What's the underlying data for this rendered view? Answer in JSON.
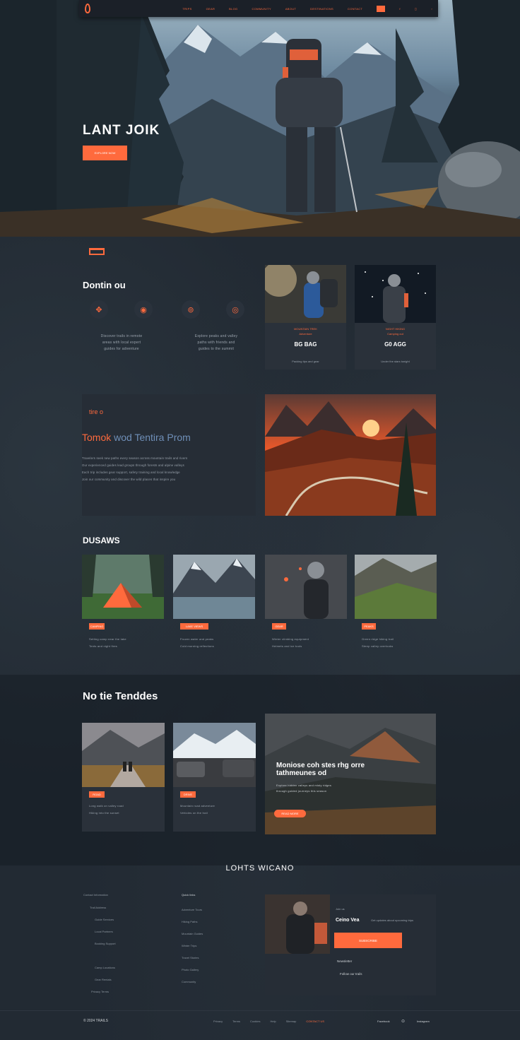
{
  "nav": {
    "links": [
      "TRIPS",
      "GEAR",
      "BLOG",
      "COMMUNITY",
      "ABOUT",
      "DESTINATIONS",
      "CONTACT"
    ],
    "badge": "EN",
    "icons": [
      "facebook-icon",
      "instagram-icon",
      "arrow-right-icon"
    ]
  },
  "hero": {
    "title": "LANT JOIK",
    "button": "EXPLORE NOW"
  },
  "features": {
    "title": "Dontin ou",
    "icons": [
      "compass-icon",
      "signal-icon",
      "target-icon",
      "location-icon"
    ],
    "text_left": [
      "Discover trails in remote",
      "areas with local expert",
      "guides for adventure"
    ],
    "text_right": [
      "Explore peaks and valley",
      "paths with friends and",
      "guides to the summit"
    ],
    "cards": [
      {
        "tag": "MOUNTAIN TREK",
        "subtag": "Adventure",
        "title": "BG BAG",
        "desc": "Packing tips and gear"
      },
      {
        "tag": "NIGHT HIKING",
        "subtag": "Camping out",
        "title": "G0 AGG",
        "desc": "Under the stars tonight"
      }
    ]
  },
  "about": {
    "kicker": "tire o",
    "title_orange": "Tomok",
    "title_rest": "wod Tentira Prom",
    "lines": [
      "Travelers seek new paths every season across mountain trails and rivers",
      "Our experienced guides lead groups through forests and alpine valleys",
      "Each trip includes gear support, safety training and local knowledge",
      "Join our community and discover the wild places that inspire you"
    ]
  },
  "gallery": {
    "title": "DUSAWS",
    "items": [
      {
        "tag": "CAMPING",
        "lines": [
          "Setting camp near the lake",
          "Tents and night fires"
        ]
      },
      {
        "tag": "LAKE VIEWS",
        "lines": [
          "Frozen water and peaks",
          "Cold morning reflections"
        ]
      },
      {
        "tag": "GEAR",
        "lines": [
          "Winter climbing equipment",
          "Helmets and ice tools"
        ]
      },
      {
        "tag": "PEAKS",
        "lines": [
          "Green ridge hiking trail",
          "Steep valley overlooks"
        ]
      }
    ]
  },
  "trending": {
    "title": "No tie Tenddes",
    "items": [
      {
        "tag": "ROAD",
        "lines": [
          "Long walk on valley road",
          "Hiking into the sunset"
        ]
      },
      {
        "tag": "DRIVE",
        "lines": [
          "Mountain road adventure",
          "Vehicles on the trail"
        ]
      }
    ],
    "feature": {
      "title": "Moniose coh stes rhg orre tathmeunes od",
      "lines": [
        "Explore hidden valleys and misty ridges",
        "through guided journeys this season"
      ],
      "button": "READ MORE"
    }
  },
  "footer_section": {
    "title": "LOHTS WICANO",
    "col1": [
      "Contact Information",
      "Trail Address",
      "Guide Services",
      "Local Partners",
      "Booking Support",
      "Camp Locations",
      "Gear Rentals",
      "Privacy Terms"
    ],
    "col2_head": "Quick links",
    "col2": [
      "Adventure Tours",
      "Hiking Paths",
      "Mountain Guides",
      "Winter Trips",
      "Travel Stories",
      "Photo Gallery",
      "Community"
    ],
    "cta": {
      "kicker": "Join us",
      "title": "Ceino Vea",
      "sub": "Get updates about upcoming trips",
      "button": "SUBSCRIBE",
      "l1": "Newsletter",
      "l2": "Follow our trails"
    }
  },
  "bottom": {
    "left": "© 2024 TRAILS",
    "middle": [
      "Privacy",
      "Terms",
      "Cookies",
      "Help",
      "Sitemap"
    ],
    "cta": "CONTACT US",
    "right": [
      "Facebook",
      "Instagram"
    ]
  }
}
